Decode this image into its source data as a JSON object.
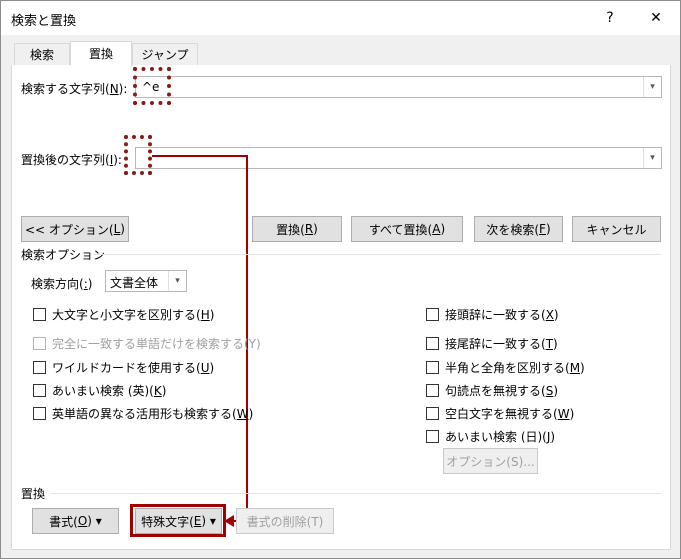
{
  "window": {
    "title": "検索と置換",
    "help_label": "?",
    "close_label": "✕"
  },
  "tabs": [
    {
      "label": "検索"
    },
    {
      "label": "置換"
    },
    {
      "label": "ジャンプ"
    }
  ],
  "find": {
    "label": "検索する文字列(",
    "accel": "N",
    "label_end": "):",
    "value": "^e"
  },
  "replace": {
    "label": "置換後の文字列(",
    "accel": "I",
    "label_end": "):",
    "value": ""
  },
  "buttons": {
    "options": {
      "text": "<< オプション(",
      "accel": "L",
      "end": ")"
    },
    "replace": {
      "text": "置換(",
      "accel": "R",
      "end": ")"
    },
    "replace_all": {
      "text": "すべて置換(",
      "accel": "A",
      "end": ")"
    },
    "find_next": {
      "text": "次を検索(",
      "accel": "F",
      "end": ")"
    },
    "cancel": "キャンセル"
  },
  "search_options": {
    "heading": "検索オプション",
    "direction_label": "検索方向(",
    "direction_accel": ":",
    "direction_end": ")",
    "direction_value": "文書全体"
  },
  "left_checks": [
    {
      "text": "大文字と小文字を区別する(",
      "accel": "H",
      "end": ")"
    },
    {
      "text": "完全に一致する単語だけを検索する(Y)",
      "accel": "",
      "end": ""
    },
    {
      "text": "ワイルドカードを使用する(",
      "accel": "U",
      "end": ")"
    },
    {
      "text": "あいまい検索 (英)(",
      "accel": "K",
      "end": ")"
    },
    {
      "text": "英単語の異なる活用形も検索する(",
      "accel": "W",
      "end": ")"
    }
  ],
  "right_checks": [
    {
      "text": "接頭辞に一致する(",
      "accel": "X",
      "end": ")"
    },
    {
      "text": "接尾辞に一致する(",
      "accel": "T",
      "end": ")"
    },
    {
      "text": "半角と全角を区別する(",
      "accel": "M",
      "end": ")"
    },
    {
      "text": "句読点を無視する(",
      "accel": "S",
      "end": ")"
    },
    {
      "text": "空白文字を無視する(",
      "accel": "W",
      "end": ")"
    },
    {
      "text": "あいまい検索 (日)(",
      "accel": "J",
      "end": ")"
    }
  ],
  "fuzzy_options_button": "オプション(S)...",
  "replace_section": {
    "heading": "置換",
    "format": {
      "text": "書式(",
      "accel": "O",
      "end": ") ▾"
    },
    "special": {
      "text": "特殊文字(",
      "accel": "E",
      "end": ") ▾"
    },
    "no_format": "書式の削除(T)"
  },
  "colors": {
    "annotation": "#a00000"
  }
}
